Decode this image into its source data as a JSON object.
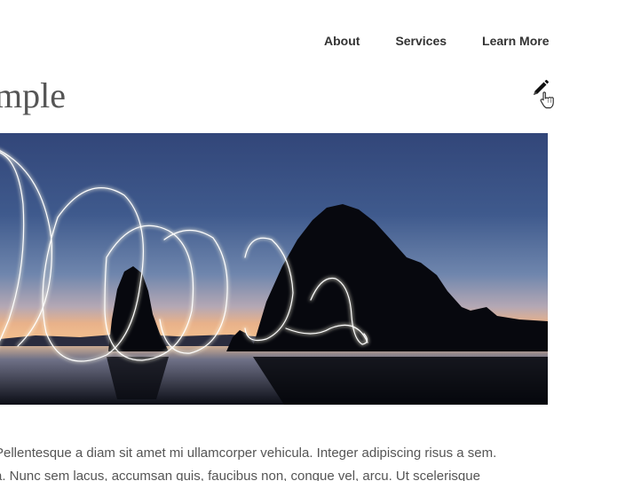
{
  "nav": {
    "items": [
      {
        "label": "About"
      },
      {
        "label": "Services"
      },
      {
        "label": "Learn More"
      }
    ]
  },
  "post": {
    "title_visible": "mple",
    "edit_icon": "pencil-icon",
    "cursor_icon": "hand-pointer-icon",
    "hero_image": "night-beach-light-painting-sea-stacks",
    "paragraph_lines": [
      "Pellentesque a diam sit amet mi ullamcorper vehicula. Integer adipiscing risus a sem.",
      "a. Nunc sem lacus, accumsan quis, faucibus non, congue vel, arcu. Ut scelerisque"
    ]
  },
  "colors": {
    "nav_text": "#333333",
    "title_text": "#555555",
    "body_text": "#555555",
    "sky_top": "#34487a",
    "sky_horizon": "#f0b48a"
  }
}
